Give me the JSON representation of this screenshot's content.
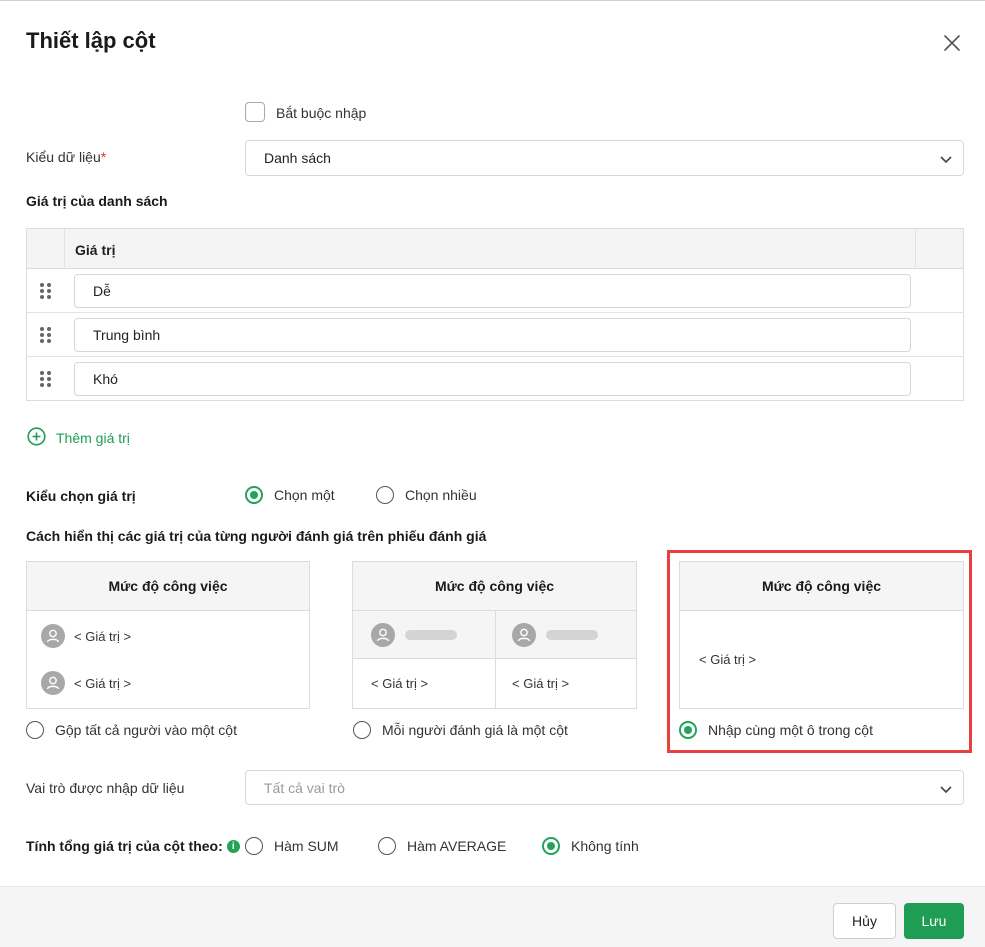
{
  "dialog": {
    "title": "Thiết lập cột",
    "required_checkbox_label": "Bắt buộc nhập",
    "data_type": {
      "label": "Kiểu dữ liệu",
      "required_mark": "*",
      "value": "Danh sách"
    },
    "list_values_heading": "Giá trị của danh sách",
    "table": {
      "header": "Giá trị",
      "rows": [
        "Dễ",
        "Trung bình",
        "Khó"
      ]
    },
    "add_value_label": "Thêm giá trị",
    "selection_type": {
      "label": "Kiểu chọn giá trị",
      "options": [
        "Chọn một",
        "Chọn nhiều"
      ],
      "selected": "Chọn một"
    },
    "display_heading": "Cách hiển thị các giá trị của từng người đánh giá trên phiếu đánh giá",
    "display_cards": {
      "card_title": "Mức độ công việc",
      "value_placeholder": "< Giá trị >",
      "options": [
        "Gộp tất cả người vào một cột",
        "Mỗi người đánh giá là một cột",
        "Nhập cùng một ô trong cột"
      ],
      "selected": "Nhập cùng một ô trong cột"
    },
    "role": {
      "label": "Vai trò được nhập dữ liệu",
      "placeholder": "Tất cả vai trò"
    },
    "total": {
      "label": "Tính tổng giá trị của cột theo:",
      "info_glyph": "i",
      "options": [
        "Hàm SUM",
        "Hàm AVERAGE",
        "Không tính"
      ],
      "selected": "Không tính"
    },
    "footer": {
      "cancel": "Hủy",
      "save": "Lưu"
    }
  },
  "colors": {
    "accent": "#1f9d55",
    "highlight": "#e8403e",
    "required": "#e0312e"
  },
  "icons": [
    "close-icon",
    "chevron-down-icon",
    "drag-handle-icon",
    "plus-circle-icon",
    "user-avatar-icon",
    "info-icon"
  ]
}
